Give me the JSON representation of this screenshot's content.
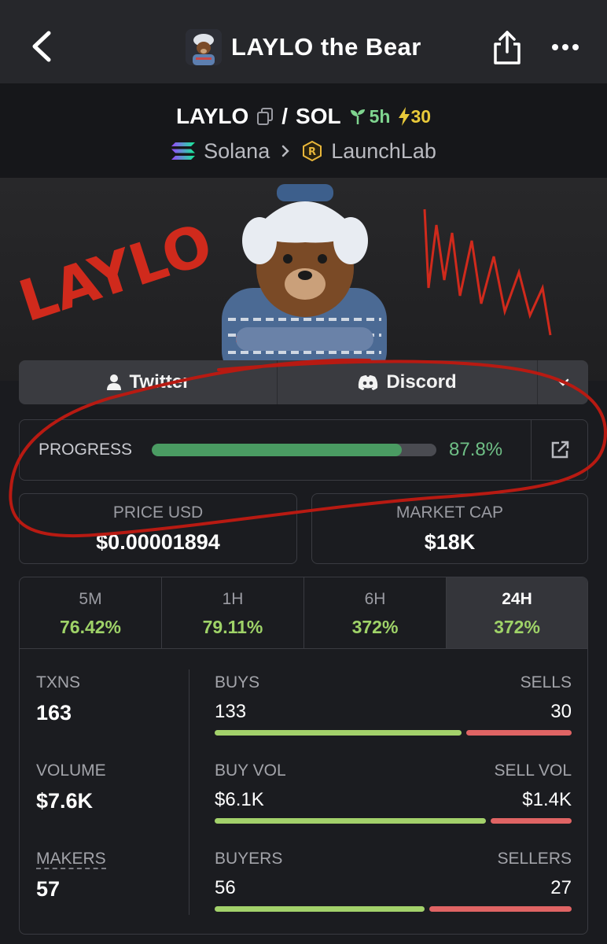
{
  "header": {
    "title": "LAYLO the Bear",
    "back_icon": "chevron-left-icon",
    "share_icon": "share-icon",
    "more_icon": "more-icon"
  },
  "pair": {
    "base": "LAYLO",
    "separator": "/",
    "quote": "SOL",
    "age": "5h",
    "boosts": "30",
    "chain": "Solana",
    "launchpad": "LaunchLab"
  },
  "banner": {
    "logo_text": "LAYLO"
  },
  "links": {
    "twitter": "Twitter",
    "discord": "Discord"
  },
  "progress": {
    "label": "PROGRESS",
    "percent": 87.8,
    "display": "87.8%"
  },
  "price": {
    "label": "PRICE USD",
    "value": "$0.00001894"
  },
  "market_cap": {
    "label": "MARKET CAP",
    "value": "$18K"
  },
  "timeframes": [
    {
      "name": "5M",
      "change": "76.42%"
    },
    {
      "name": "1H",
      "change": "79.11%"
    },
    {
      "name": "6H",
      "change": "372%"
    },
    {
      "name": "24H",
      "change": "372%",
      "active": true
    }
  ],
  "stats": {
    "txns": {
      "label": "TXNS",
      "value": "163"
    },
    "volume": {
      "label": "VOLUME",
      "value": "$7.6K"
    },
    "makers": {
      "label": "MAKERS",
      "value": "57"
    },
    "buys": {
      "label": "BUYS",
      "value": "133",
      "count": 133
    },
    "sells": {
      "label": "SELLS",
      "value": "30",
      "count": 30
    },
    "buy_vol": {
      "label": "BUY VOL",
      "value": "$6.1K",
      "amount": 6.1
    },
    "sell_vol": {
      "label": "SELL VOL",
      "value": "$1.4K",
      "amount": 1.4
    },
    "buyers": {
      "label": "BUYERS",
      "value": "56",
      "count": 56
    },
    "sellers": {
      "label": "SELLERS",
      "value": "27",
      "count": 27
    }
  },
  "colors": {
    "background": "#1a1b1f",
    "positive": "#9fd368",
    "buy_bar": "#a3d16b",
    "sell_bar": "#e06464",
    "progress_fill": "#4a9b62",
    "annotation": "#b81a12"
  }
}
